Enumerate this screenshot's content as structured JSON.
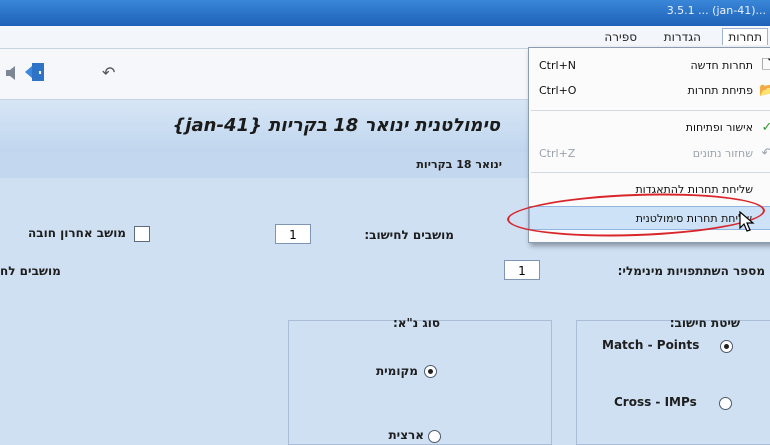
{
  "titlebar": {
    "text": "...(jan-41) ...  3.5.1"
  },
  "menubar": {
    "tabs": [
      {
        "label": "תחרות",
        "active": true
      },
      {
        "label": "הגדרות",
        "active": false
      },
      {
        "label": "ספירה",
        "active": false
      }
    ]
  },
  "toolbar": {
    "icons": [
      "speaker-icon",
      "exit-door-icon",
      "undo-icon"
    ]
  },
  "header": {
    "title": "סימולטנית ינואר 18 בקריות {jan-41}"
  },
  "strip": {
    "text": "ינואר 18 בקריות"
  },
  "form": {
    "seats_to_count_label": "מושבים לחישוב:",
    "seats_to_count_value": "1",
    "last_seat_label": "מושב אחרון חובה",
    "min_participants_label": "מספר השתתפויות מינימלי:",
    "min_participants_value": "1",
    "seats_partial_label": "מושבים לח",
    "calc_method_label": "שיטת חישוב:",
    "calc_options": [
      "Match - Points",
      "Cross - IMPs"
    ],
    "nt_type_label": "סוג נ\"א:",
    "nt_options": [
      "מקומית",
      "ארצית"
    ]
  },
  "dropdown": {
    "items": [
      {
        "label": "תחרות חדשה",
        "shortcut": "Ctrl+N",
        "icon": "new-doc-icon",
        "disabled": false
      },
      {
        "label": "פתיחת תחרות",
        "shortcut": "Ctrl+O",
        "icon": "open-folder-icon",
        "disabled": false
      },
      {
        "label": "אישור ופתיחות",
        "shortcut": "",
        "icon": "check-icon",
        "disabled": false
      },
      {
        "label": "שחזור נתונים",
        "shortcut": "Ctrl+Z",
        "icon": "restore-icon",
        "disabled": true
      },
      {
        "label": "שליחת תחרות להתאגדות",
        "shortcut": "",
        "icon": "",
        "disabled": false
      },
      {
        "label": "שליחת תחרות סימולטנית",
        "shortcut": "",
        "icon": "",
        "disabled": false
      }
    ]
  },
  "colors": {
    "highlight": "#cde2f7",
    "annotation": "#d9262b",
    "titlebar": "#2a74cc"
  }
}
